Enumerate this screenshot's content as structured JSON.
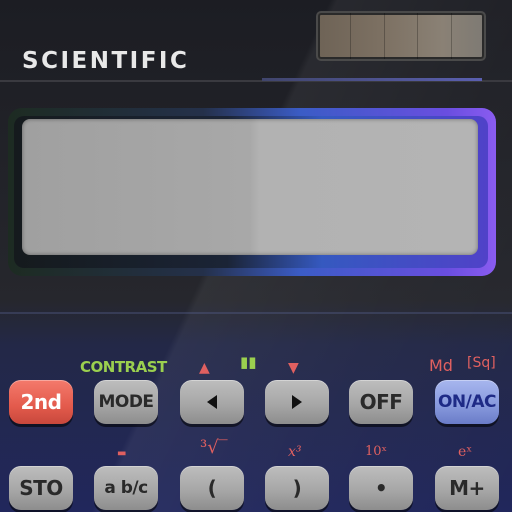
{
  "header": {
    "brand": "SCIENTIFIC"
  },
  "display": {
    "value": ""
  },
  "secondary_labels": {
    "contrast": "CONTRAST",
    "up_arrow": "▲",
    "bars": "▮▮",
    "down_arrow": "▼",
    "md": "Md",
    "sq": "[Sq]",
    "dot": "▬",
    "sqrt": "³√‾",
    "x_cubed": "x³",
    "ten_pow": "10ˣ",
    "e_pow": "eˣ"
  },
  "keys": {
    "second": "2nd",
    "mode": "MODE",
    "left_arrow": "left-arrow-icon",
    "right_arrow": "right-arrow-icon",
    "off": "OFF",
    "on_ac": "ON/AC",
    "sto": "STO",
    "abc": "a b/c",
    "lparen": "(",
    "rparen": ")",
    "decimal": "•",
    "m_plus": "M+"
  },
  "colors": {
    "red_key": "#e35a4c",
    "gray_key": "#a7a7a7",
    "blue_key": "#8698dc",
    "secondary_red": "#e06060",
    "secondary_green": "#9bd04f"
  }
}
